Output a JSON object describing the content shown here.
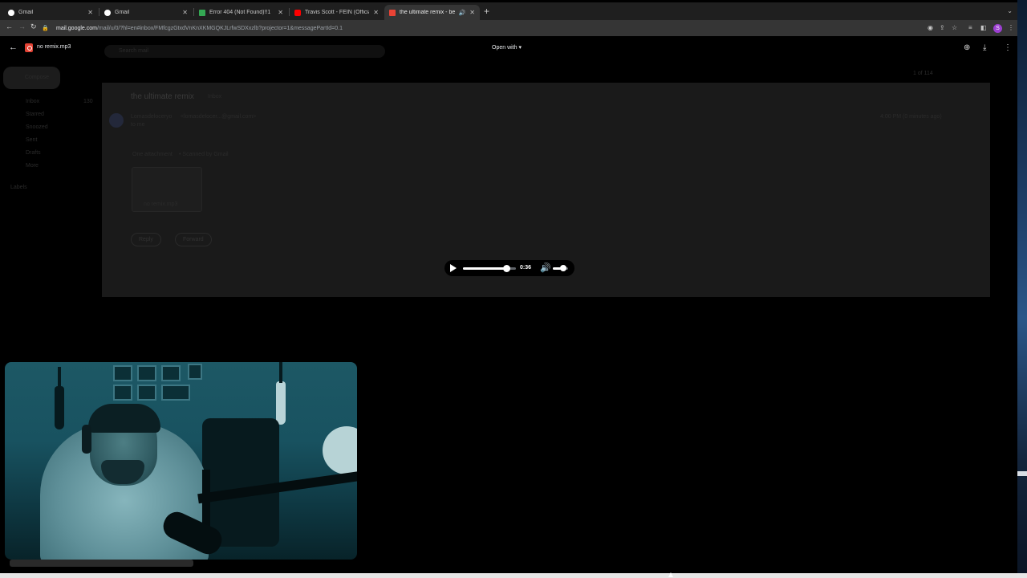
{
  "browser": {
    "tabs": [
      {
        "title": "Gmail",
        "favicon_color": "#ffffff"
      },
      {
        "title": "Gmail",
        "favicon_color": "#ffffff"
      },
      {
        "title": "Error 404 (Not Found)!!1",
        "favicon_color": "#34a853"
      },
      {
        "title": "Travis Scott - FEIN (Official A...",
        "favicon_color": "#ff0000"
      },
      {
        "title": "the ultimate remix - beats...",
        "favicon_color": "#ea4335",
        "active": true
      }
    ],
    "url_host": "mail.google.com",
    "url_path": "/mail/u/0/?hl=en#inbox/FMfcgzGtxdVnKnXKMGQKJLrfwSDXxzlb?projector=1&messagePartId=0.1",
    "profile_initial": "S"
  },
  "viewer": {
    "file_name": "no remix.mp3",
    "open_with": "Open with"
  },
  "gmail_background": {
    "search_placeholder": "Search mail",
    "compose": "Compose",
    "nav": [
      {
        "label": "Inbox",
        "count": "130"
      },
      {
        "label": "Starred",
        "count": ""
      },
      {
        "label": "Snoozed",
        "count": ""
      },
      {
        "label": "Sent",
        "count": ""
      },
      {
        "label": "Drafts",
        "count": ""
      },
      {
        "label": "More",
        "count": ""
      }
    ],
    "labels_heading": "Labels",
    "page_count": "1 of 114",
    "subject": "the ultimate remix",
    "subject_tag": "Inbox",
    "sender_name": "Lomasdeloceryo",
    "sender_email": "<lomasdelocer...@gmail.com>",
    "to_me": "to me",
    "time_ago": "4:00 PM (0 minutes ago)",
    "attachment_heading": "One attachment",
    "scanned": "• Scanned by Gmail",
    "attachment_name": "no remix.mp3",
    "reply": "Reply",
    "forward": "Forward"
  },
  "player": {
    "time": "0:36",
    "progress": 0.82,
    "volume": 0.7
  },
  "colors": {
    "accent_profile": "#9c3fd1",
    "file_icon": "#e34234"
  }
}
